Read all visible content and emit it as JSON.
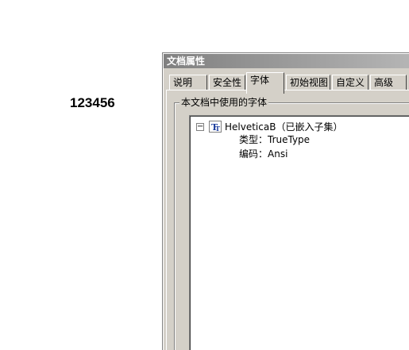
{
  "document": {
    "text": "123456"
  },
  "dialog": {
    "title": "文档属性",
    "tabs": [
      {
        "label": "说明"
      },
      {
        "label": "安全性"
      },
      {
        "label": "字体",
        "active": true
      },
      {
        "label": "初始视图"
      },
      {
        "label": "自定义"
      },
      {
        "label": "高级"
      }
    ],
    "fonts_group": {
      "label": "本文档中使用的字体",
      "items": [
        {
          "expander": "−",
          "name": "HelveticaB（已嵌入子集）",
          "icon": "truetype-font-icon",
          "type_line": "类型：TrueType",
          "encoding_line": "编码：Ansi"
        }
      ]
    }
  }
}
